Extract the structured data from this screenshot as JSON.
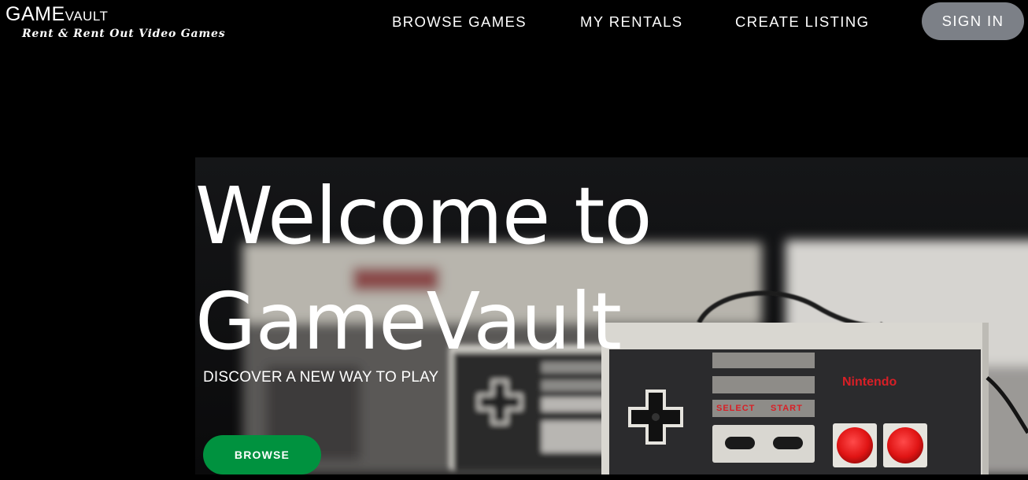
{
  "brand": {
    "name_part1": "GAME",
    "name_part2": "VAULT",
    "tagline": "Rent & Rent Out Video Games"
  },
  "nav": {
    "browse_games": "BROWSE GAMES",
    "my_rentals": "MY RENTALS",
    "create_listing": "CREATE LISTING",
    "sign_in": "SIGN IN"
  },
  "hero": {
    "title": "Welcome to\nGameVault",
    "subtitle": "DISCOVER A NEW WAY TO PLAY",
    "cta_label": "BROWSE",
    "controller_brand": "Nintendo",
    "controller_select": "SELECT",
    "controller_start": "START"
  },
  "colors": {
    "background": "#000000",
    "signin_bg": "#7c8087",
    "cta_bg": "#00923f",
    "nintendo_red": "#d81f26"
  },
  "icons": {
    "hero_image": "nes-console-and-controller-photo"
  }
}
